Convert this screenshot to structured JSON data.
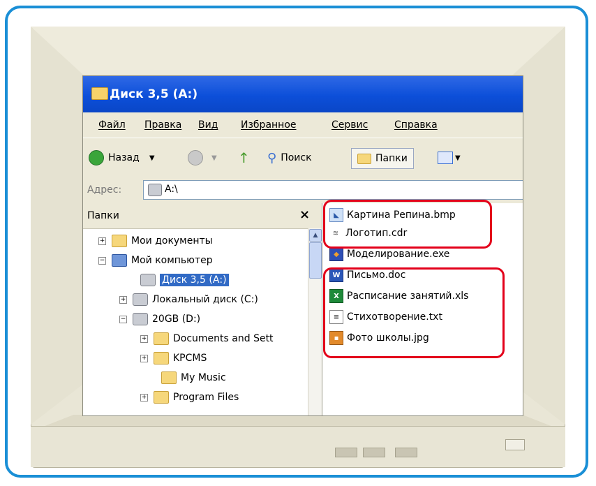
{
  "window": {
    "title": "Диск 3,5 (А:)"
  },
  "menu": [
    "Файл",
    "Правка",
    "Вид",
    "Избранное",
    "Сервис",
    "Справка"
  ],
  "toolbar": {
    "back_label": "Назад",
    "search_label": "Поиск",
    "folders_label": "Папки"
  },
  "address": {
    "label": "Адрес:",
    "value": "A:\\"
  },
  "folders_pane": {
    "title": "Папки",
    "close_glyph": "×",
    "items": [
      {
        "label": "Мои документы",
        "expander": "+"
      },
      {
        "label": "Мой компьютер",
        "expander": "−"
      },
      {
        "label": "Диск 3,5 (А:)",
        "selected": true
      },
      {
        "label": "Локальный диск (С:)",
        "expander": "+"
      },
      {
        "label": "20GB (D:)",
        "expander": "−"
      },
      {
        "label": "Documents and Sett",
        "expander": "+"
      },
      {
        "label": "KPCMS",
        "expander": "+"
      },
      {
        "label": "My Music"
      },
      {
        "label": "Program Files",
        "expander": "+"
      }
    ]
  },
  "files": [
    {
      "name": "Картина Репина.bmp",
      "icon": "paint-icon"
    },
    {
      "name": "Логотип.cdr",
      "icon": "coreldraw-icon"
    },
    {
      "name": "Моделирование.exe",
      "icon": "app-icon"
    },
    {
      "name": "Письмо.doc",
      "icon": "word-icon"
    },
    {
      "name": "Расписание занятий.xls",
      "icon": "excel-icon"
    },
    {
      "name": "Стихотворение.txt",
      "icon": "text-icon"
    },
    {
      "name": "Фото школы.jpg",
      "icon": "image-icon"
    }
  ],
  "colors": {
    "title_bar": "#0c4fd9",
    "highlight": "#e3001a",
    "frame": "#1a8fd6",
    "selection": "#316ac5"
  }
}
